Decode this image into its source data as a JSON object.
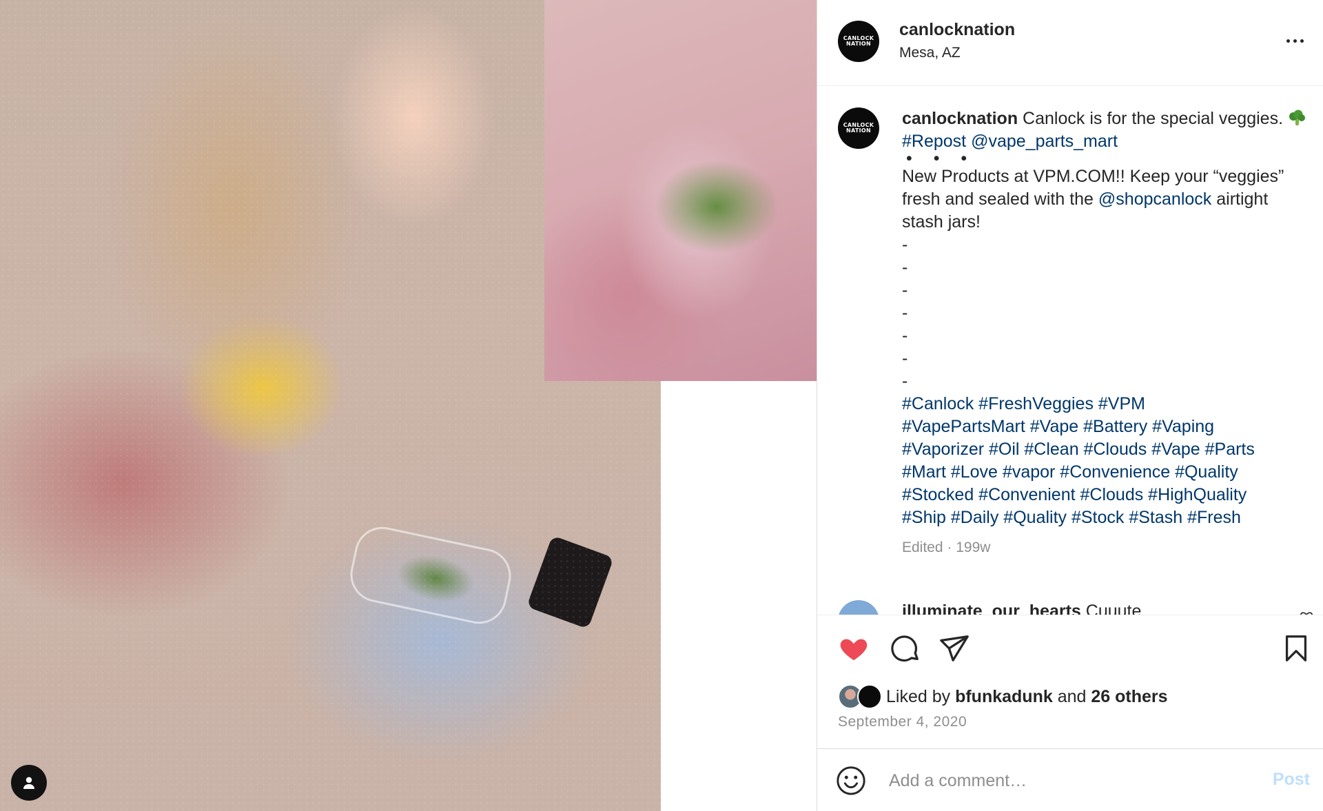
{
  "post": {
    "author": {
      "username": "canlocknation",
      "location": "Mesa, AZ",
      "avatar_text": "CANLOCK NATION"
    },
    "caption": {
      "username": "canlocknation",
      "line1": "Canlock is for the special veggies.",
      "broccoli_emoji": "🥦",
      "repost_tag": "#Repost",
      "repost_mention": "@vape_parts_mart",
      "dots": "• • •",
      "body_part1": "New Products at VPM.COM!! Keep your “veggies” fresh and sealed with the",
      "shop_mention": "@shopcanlock",
      "body_part2": "airtight stash jars!",
      "dashes": [
        "-",
        "-",
        "-",
        "-",
        "-",
        "-",
        "-"
      ],
      "hashtag_lines": [
        "#Canlock #FreshVeggies #VPM",
        "#VapePartsMart #Vape #Battery #Vaping",
        "#Vaporizer #Oil #Clean #Clouds #Vape #Parts",
        "#Mart #Love #vapor #Convenience #Quality",
        "#Stocked #Convenient #Clouds #HighQuality",
        "#Ship #Daily #Quality #Stock #Stash #Fresh"
      ],
      "meta": "Edited · 199w"
    },
    "next_comment": {
      "username": "illuminate_our_hearts",
      "text": "Cuuute"
    },
    "likes": {
      "prefix": "Liked by",
      "first_liker": "bfunkadunk",
      "and": "and",
      "others": "26 others"
    },
    "date": "September 4, 2020",
    "add_comment": {
      "placeholder": "Add a comment…",
      "post_label": "Post"
    }
  },
  "icons": {
    "like": "heart-filled-icon",
    "comment": "comment-bubble-icon",
    "share": "paper-plane-icon",
    "save": "bookmark-icon",
    "more": "ellipsis-icon",
    "emoji": "smiley-icon",
    "user_tag": "person-icon"
  },
  "colors": {
    "like_red": "#ed4956",
    "link_blue": "#00376b",
    "muted_gray": "#8e8e8e",
    "post_button_disabled": "#c0dffd",
    "text": "#262626"
  }
}
